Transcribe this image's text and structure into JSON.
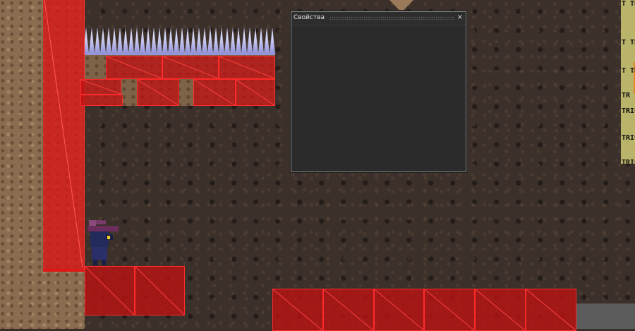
{
  "properties_window": {
    "title": "Свойства",
    "close_glyph": "×"
  },
  "trigger_labels": [
    "T TR",
    "T TR",
    "T TR",
    "TR",
    "TRIG",
    "TRIG",
    "TRIG"
  ],
  "colors": {
    "solid_block": "#be1212",
    "block_outline": "#ff2a2a",
    "panel_bg": "#2a2a2a",
    "trigger_zone": "#b9b46a"
  }
}
